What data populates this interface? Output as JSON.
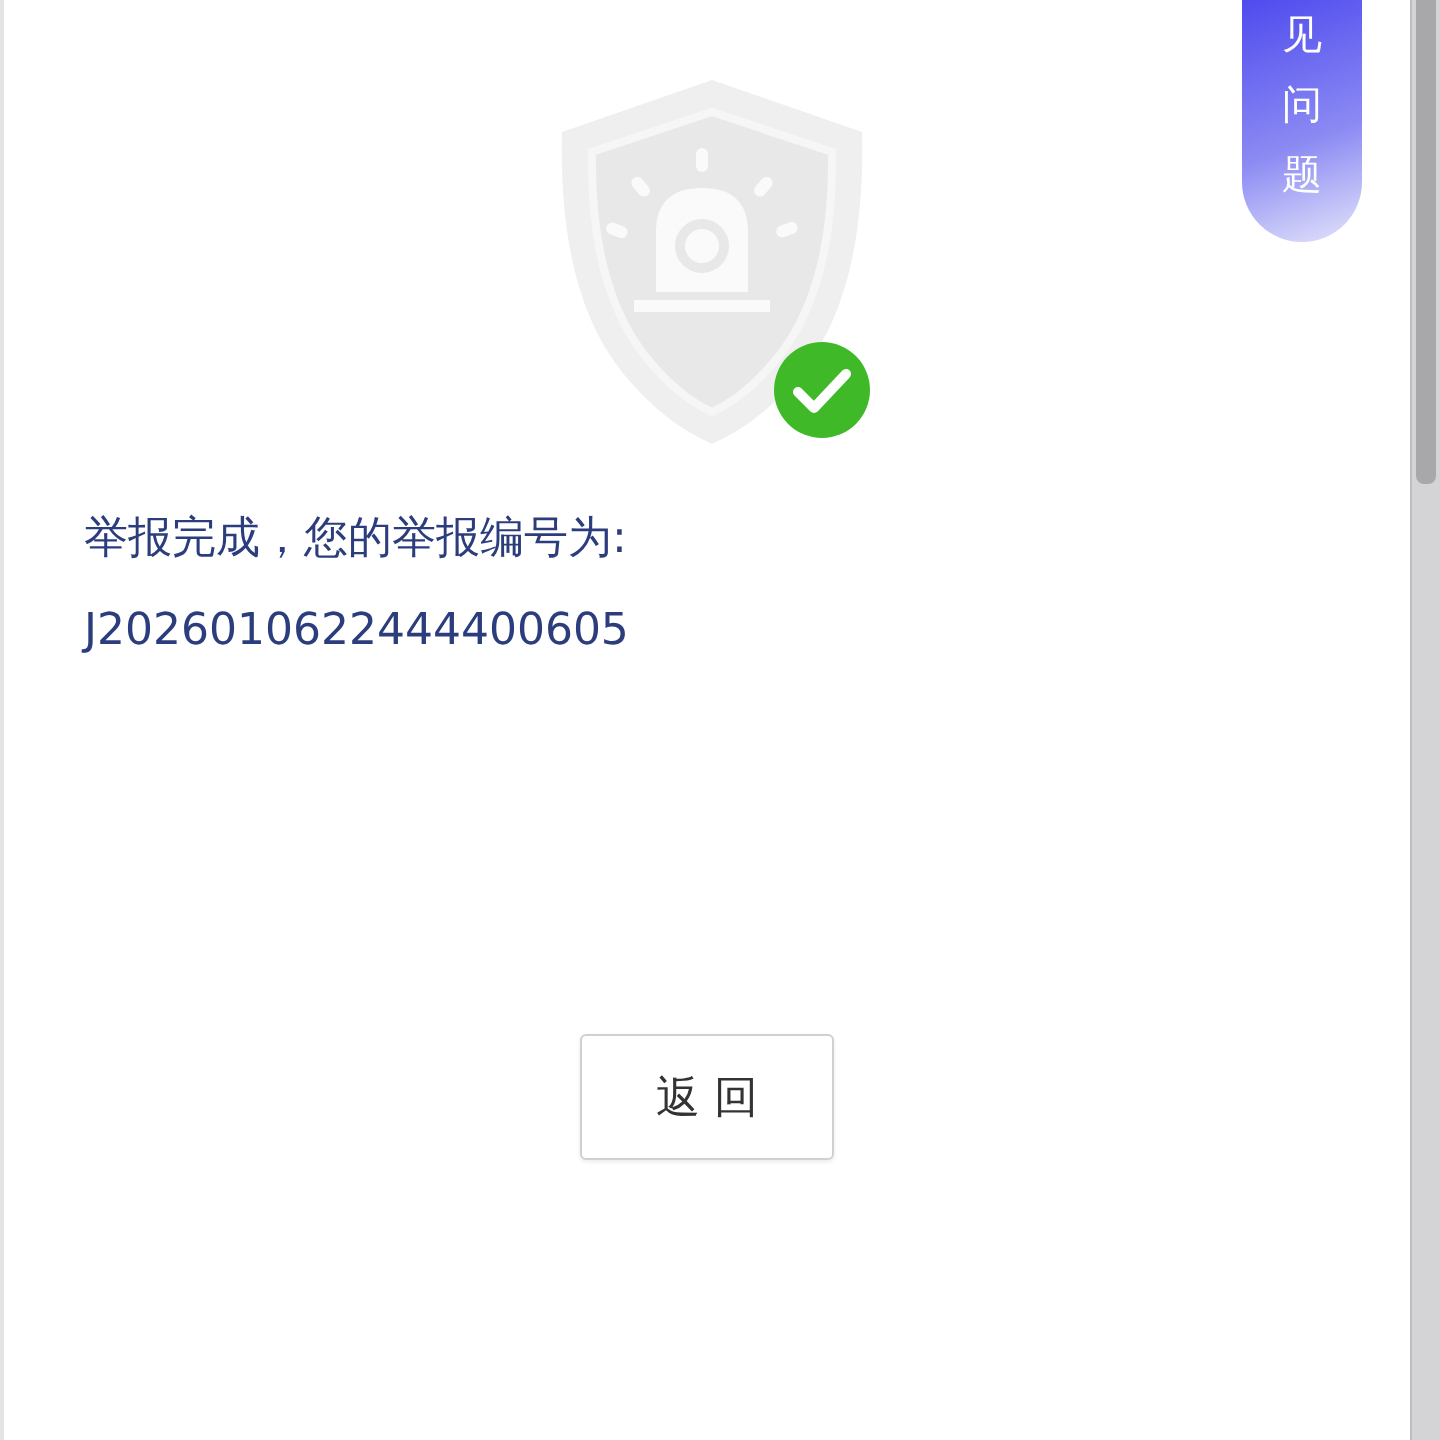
{
  "help_tab": {
    "label": "见问题"
  },
  "result": {
    "message": "举报完成，您的举报编号为:",
    "report_number": "J2026010622444400605"
  },
  "buttons": [
    {
      "label": "返 回"
    }
  ]
}
